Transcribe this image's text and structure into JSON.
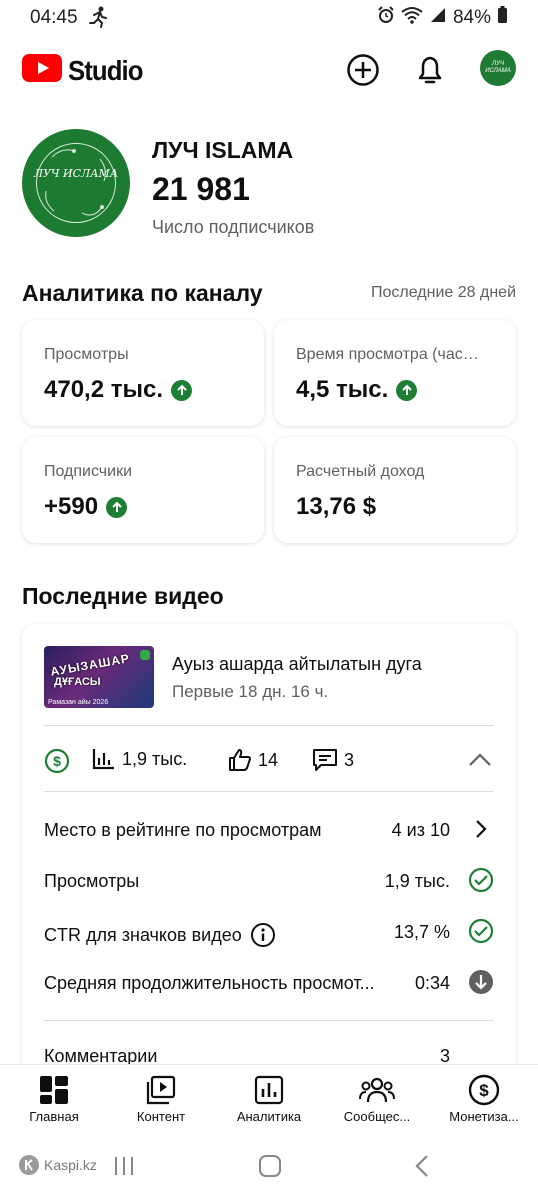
{
  "status_bar": {
    "time": "04:45",
    "battery": "84%"
  },
  "header": {
    "app_name": "Studio"
  },
  "channel": {
    "avatar_text": "ЛУЧ ИСЛАМА",
    "name": "ЛУЧ ISLAMA",
    "subscribers": "21 981",
    "subscribers_label": "Число подписчиков"
  },
  "analytics": {
    "title": "Аналитика по каналу",
    "period": "Последние 28 дней",
    "cards": [
      {
        "label": "Просмотры",
        "value": "470,2 тыс.",
        "trend": "up"
      },
      {
        "label": "Время просмотра (час…",
        "value": "4,5 тыс.",
        "trend": "up"
      },
      {
        "label": "Подписчики",
        "value": "+590",
        "trend": "up"
      },
      {
        "label": "Расчетный доход",
        "value": "13,76 $",
        "trend": "none"
      }
    ]
  },
  "latest": {
    "title": "Последние видео",
    "video": {
      "thumb_line1": "АУЫЗАШАР",
      "thumb_line2": "ДҰҒАСЫ",
      "thumb_caption": "Рамазан айы 2026",
      "title": "Ауыз ашарда айтылатын дуга",
      "subtitle": "Первые 18 дн. 16 ч.",
      "views": "1,9 тыс.",
      "likes": "14",
      "comments": "3"
    },
    "rows": [
      {
        "label": "Место в рейтинге по просмотрам",
        "value": "4 из 10",
        "icon": "chevron-right"
      },
      {
        "label": "Просмотры",
        "value": "1,9 тыс.",
        "icon": "check-circle"
      },
      {
        "label": "CTR для значков видео",
        "value": "13,7 %",
        "icon": "check-circle",
        "info": true
      },
      {
        "label": "Средняя продолжительность просмот...",
        "value": "0:34",
        "icon": "down-circle"
      },
      {
        "label": "Комментарии",
        "value": "3",
        "icon": "none"
      }
    ]
  },
  "bottom_nav": [
    {
      "label": "Главная",
      "icon": "dashboard-icon"
    },
    {
      "label": "Контент",
      "icon": "content-icon"
    },
    {
      "label": "Аналитика",
      "icon": "analytics-icon"
    },
    {
      "label": "Сообщес...",
      "icon": "community-icon"
    },
    {
      "label": "Монетиза...",
      "icon": "monetization-icon"
    }
  ],
  "watermark": "Kaspi.kz",
  "colors": {
    "brand_red": "#ff0000",
    "success_green": "#1e7f34",
    "muted": "#606060",
    "channel_green": "#1c7a31"
  }
}
